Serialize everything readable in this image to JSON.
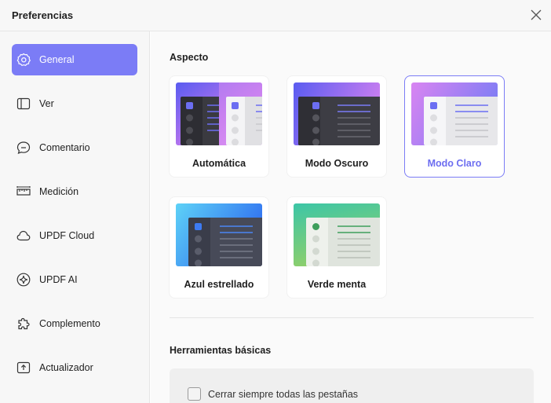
{
  "window": {
    "title": "Preferencias"
  },
  "sidebar": {
    "items": [
      {
        "label": "General",
        "icon": "gear-icon",
        "active": true
      },
      {
        "label": "Ver",
        "icon": "panel-icon"
      },
      {
        "label": "Comentario",
        "icon": "comment-icon"
      },
      {
        "label": "Medición",
        "icon": "ruler-icon"
      },
      {
        "label": "UPDF Cloud",
        "icon": "cloud-icon"
      },
      {
        "label": "UPDF AI",
        "icon": "ai-sparkle-icon"
      },
      {
        "label": "Complemento",
        "icon": "puzzle-icon"
      },
      {
        "label": "Actualizador",
        "icon": "update-icon"
      }
    ]
  },
  "appearance": {
    "title": "Aspecto",
    "themes": [
      {
        "label": "Automática"
      },
      {
        "label": "Modo Oscuro"
      },
      {
        "label": "Modo Claro",
        "selected": true
      },
      {
        "label": "Azul estrellado"
      },
      {
        "label": "Verde menta"
      }
    ]
  },
  "basic_tools": {
    "title": "Herramientas básicas",
    "close_all_tabs_label": "Cerrar siempre todas las pestañas",
    "close_all_tabs_checked": false
  },
  "colors": {
    "accent": "#7b7cf6",
    "sidebar_bg": "#f7f7f7"
  }
}
